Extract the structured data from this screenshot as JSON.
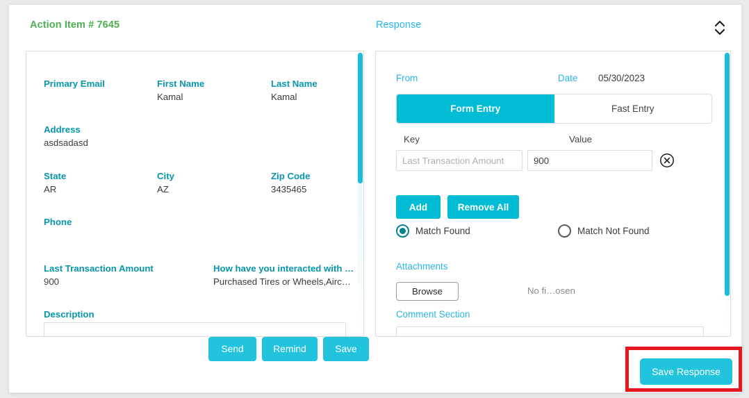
{
  "header": {
    "title": "Action Item # 7645",
    "response_label": "Response",
    "sorter_icon": "chevron-up-down-icon"
  },
  "left_panel": {
    "fields": [
      {
        "label": "Primary Email",
        "value": ""
      },
      {
        "label": "First Name",
        "value": "Kamal"
      },
      {
        "label": "Last Name",
        "value": "Kamal"
      },
      {
        "label": "Address",
        "value": "asdsadasd"
      },
      {
        "label": "State",
        "value": "AR"
      },
      {
        "label": "City",
        "value": "AZ"
      },
      {
        "label": "Zip Code",
        "value": "3435465"
      },
      {
        "label": "Phone",
        "value": ""
      },
      {
        "label": "Last Transaction Amount",
        "value": "900"
      },
      {
        "label": "How have you interacted with …",
        "value": "Purchased Tires or Wheels,Airc…"
      },
      {
        "label": "Description",
        "value": ""
      }
    ],
    "description_value": "",
    "scrollbar": {
      "name": "left-panel-scrollbar"
    }
  },
  "right_panel": {
    "from_label": "From",
    "from_value": "",
    "date_label": "Date",
    "date_value": "05/30/2023",
    "tabs": [
      {
        "label": "Form Entry",
        "active": true
      },
      {
        "label": "Fast Entry",
        "active": false
      }
    ],
    "key_column_header": "Key",
    "value_column_header": "Value",
    "key_input": {
      "value": "",
      "placeholder": "Last Transaction Amount"
    },
    "value_input": {
      "value": "900",
      "placeholder": ""
    },
    "remove_row_icon": "circle-close-icon",
    "add_label": "Add",
    "remove_all_label": "Remove All",
    "match_found_label": "Match Found",
    "match_not_found_label": "Match Not Found",
    "match_selected": "Match Found",
    "attachments_label": "Attachments",
    "browse_label": "Browse",
    "no_file_text": "No fi…osen",
    "comment_section_label": "Comment Section",
    "comment_value": "",
    "scrollbar": {
      "name": "right-panel-scrollbar"
    }
  },
  "footer": {
    "send_label": "Send",
    "remind_label": "Remind",
    "save_label": "Save",
    "save_response_label": "Save Response"
  },
  "colors": {
    "accent_cyan": "#00bcd4",
    "label_teal": "#0596ab",
    "light_blue": "#29b6e8",
    "title_green": "#4caf50",
    "highlight_red": "#e8161f",
    "radio_selected": "#00838f"
  }
}
